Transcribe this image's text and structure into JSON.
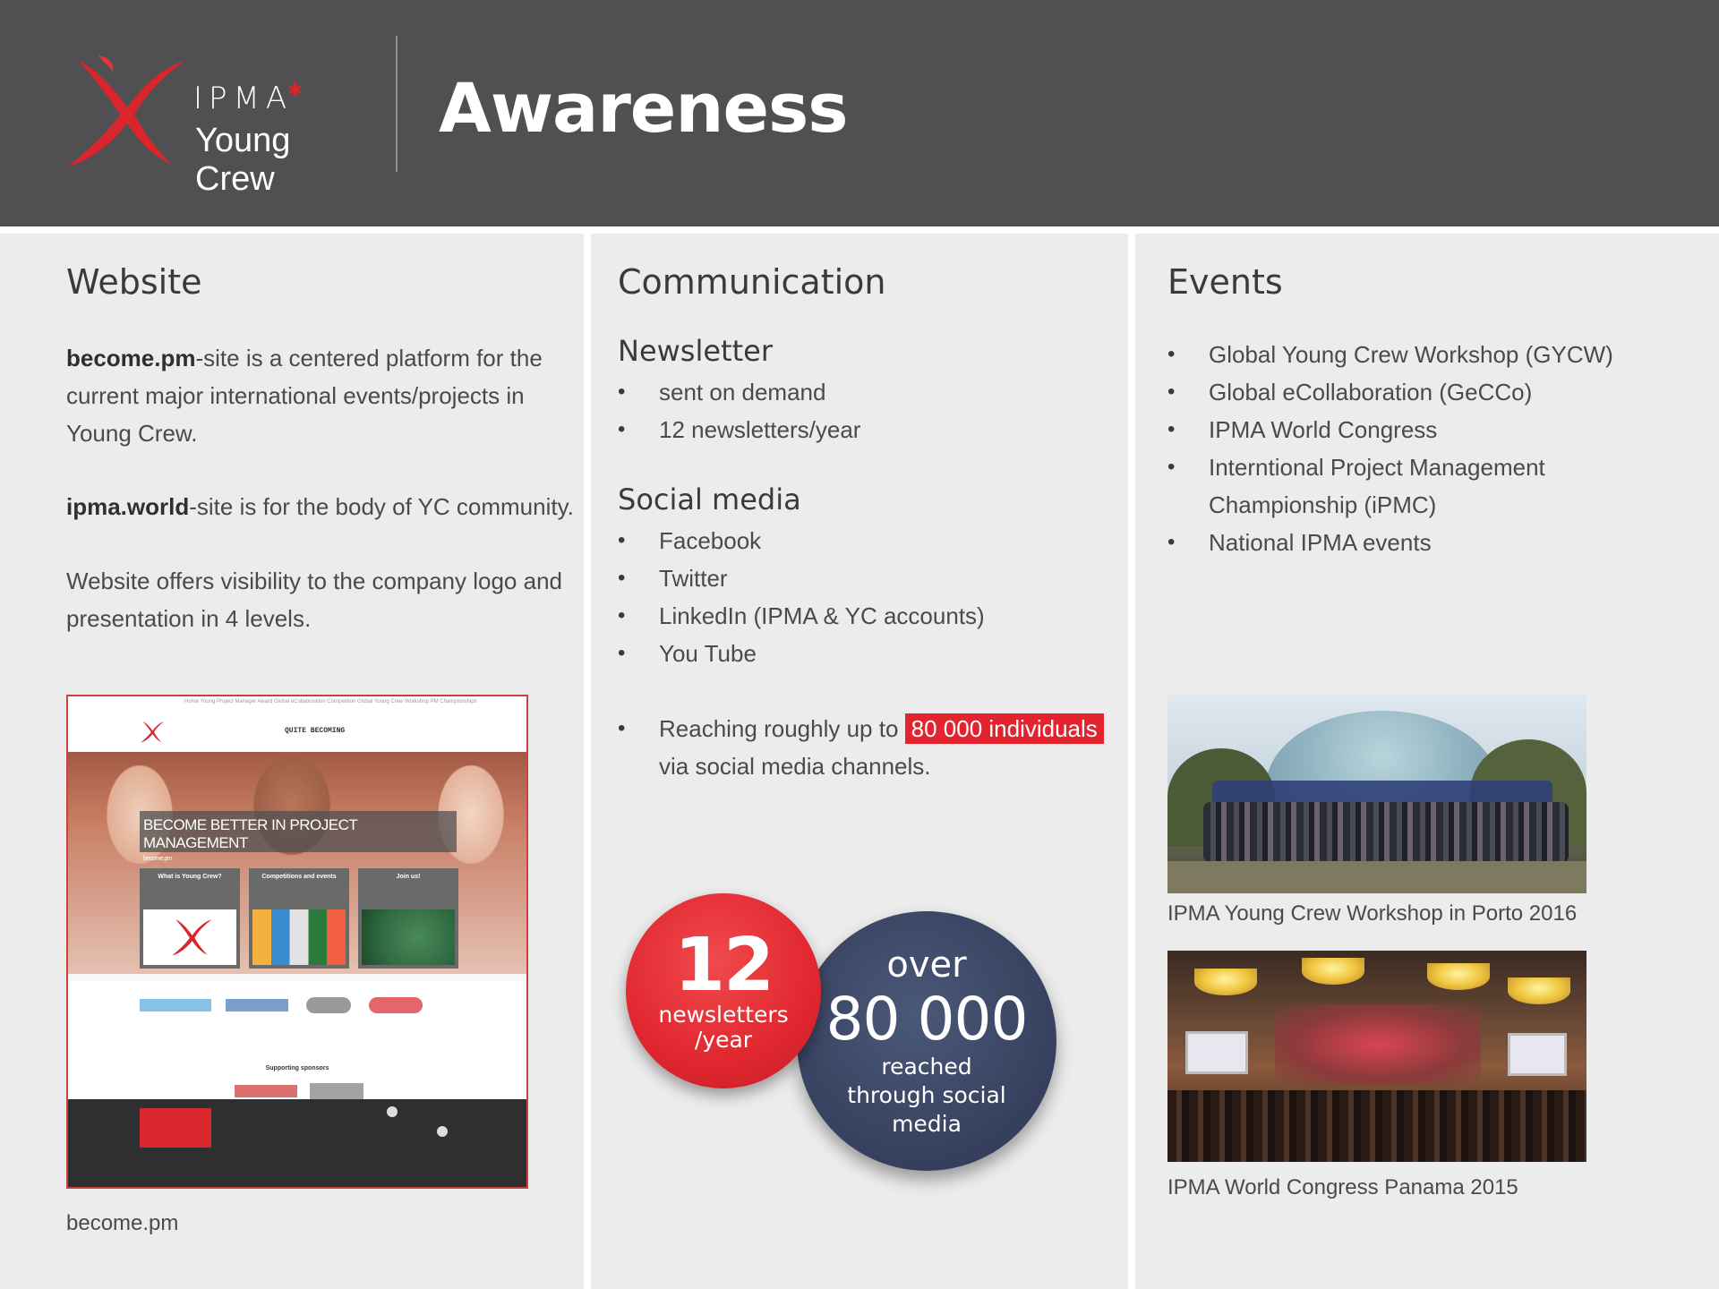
{
  "header": {
    "logo_ipma": "IPMA",
    "logo_young_crew": "Young Crew",
    "title": "Awareness"
  },
  "website": {
    "title": "Website",
    "p1_bold": "become.pm",
    "p1_rest": "-site is a centered platform for the current major international events/projects in Young Crew.",
    "p2_bold": "ipma.world",
    "p2_rest": "-site is for the body of YC community.",
    "p3": "Website offers visibility to the company logo and presentation in 4 levels.",
    "screenshot": {
      "nav": "Home   Young Project Manager Award   Global eCollaboration Competition   Global Young Crew Workshop   PM Championships",
      "header_center": "QUITE BECOMING",
      "banner": "BECOME BETTER IN PROJECT MANAGEMENT",
      "banner_sub": "become.pm",
      "card1": "What is Young Crew?",
      "card2": "Competitions and events",
      "card3": "Join us!",
      "sponsors_title": "Supporting sponsors"
    },
    "caption": "become.pm"
  },
  "communication": {
    "title": "Communication",
    "newsletter_title": "Newsletter",
    "newsletter_items": [
      "sent on demand",
      "12 newsletters/year"
    ],
    "social_title": "Social media",
    "social_items": [
      "Facebook",
      "Twitter",
      "LinkedIn (IPMA & YC accounts)",
      "You Tube"
    ],
    "reach_prefix": "Reaching roughly up to",
    "reach_highlight": "80 000 individuals",
    "reach_suffix": "via social media channels.",
    "circle_red": {
      "number": "12",
      "label_line1": "newsletters",
      "label_line2": "/year"
    },
    "circle_navy": {
      "over": "over",
      "number": "80 000",
      "line1": "reached",
      "line2": "through social",
      "line3": "media"
    }
  },
  "events": {
    "title": "Events",
    "items": [
      "Global Young Crew Workshop (GYCW)",
      "Global eCollaboration (GeCCo)",
      "IPMA World Congress",
      "Interntional Project Management Championship (iPMC)",
      "National IPMA events"
    ],
    "photo1_caption": "IPMA Young Crew Workshop in Porto 2016",
    "photo2_caption": "IPMA World Congress Panama 2015"
  },
  "colors": {
    "header_bg": "#505053",
    "brand_red": "#e3232e",
    "navy": "#36405e",
    "panel_bg": "#ececec"
  }
}
